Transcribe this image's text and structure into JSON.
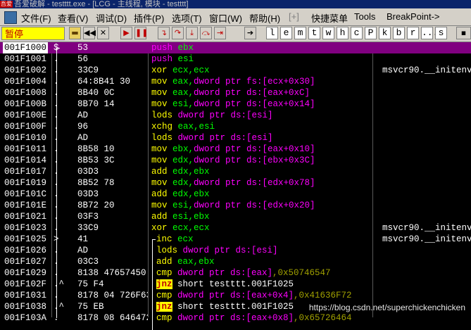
{
  "window": {
    "app_icon_text": "吾爱",
    "title": "吾爱破解 - testttt.exe - [LCG - 主线程, 模块 - testttt]"
  },
  "menu": [
    {
      "label": "文件(F)",
      "name": "menu-file"
    },
    {
      "label": "查看(V)",
      "name": "menu-view"
    },
    {
      "label": "调试(D)",
      "name": "menu-debug"
    },
    {
      "label": "插件(P)",
      "name": "menu-plugins"
    },
    {
      "label": "选项(T)",
      "name": "menu-options"
    },
    {
      "label": "窗口(W)",
      "name": "menu-window"
    },
    {
      "label": "帮助(H)",
      "name": "menu-help"
    },
    {
      "label": "[+]",
      "name": "menu-plus"
    },
    {
      "label": "快捷菜单",
      "name": "menu-shortcuts"
    },
    {
      "label": "Tools",
      "name": "menu-tools"
    },
    {
      "label": "BreakPoint->",
      "name": "menu-breakpoint"
    }
  ],
  "toolbar": {
    "status": "暂停",
    "buttons": [
      "open",
      "rewind",
      "close",
      "run",
      "pause",
      "step-into",
      "step-over",
      "trace-into",
      "trace-over",
      "execute-till-return",
      "goto"
    ],
    "letters": [
      "l",
      "e",
      "m",
      "t",
      "w",
      "h",
      "c",
      "P",
      "k",
      "b",
      "r",
      "...",
      "s"
    ]
  },
  "rows": [
    {
      "addr": "001F1000",
      "mark": "$",
      "hex": "53",
      "asm": [
        [
          "push",
          "purple"
        ],
        [
          " ebx",
          "reg"
        ]
      ],
      "cmt": "",
      "sel": true
    },
    {
      "addr": "001F1001",
      "mark": ".",
      "hex": "56",
      "asm": [
        [
          "push",
          "purple"
        ],
        [
          " esi",
          "reg"
        ]
      ],
      "cmt": ""
    },
    {
      "addr": "001F1002",
      "mark": ".",
      "hex": "33C9",
      "asm": [
        [
          "xor",
          "yellow"
        ],
        [
          " ecx,ecx",
          "reg"
        ]
      ],
      "cmt": "msvcr90.__initenv"
    },
    {
      "addr": "001F1004",
      "mark": ".",
      "hex": "64:8B41 30",
      "asm": [
        [
          "mov",
          "yellow"
        ],
        [
          " eax,",
          "reg"
        ],
        [
          "dword ptr fs:[ecx+0x30]",
          "mem"
        ]
      ],
      "cmt": ""
    },
    {
      "addr": "001F1008",
      "mark": ".",
      "hex": "8B40 0C",
      "asm": [
        [
          "mov",
          "yellow"
        ],
        [
          " eax,",
          "reg"
        ],
        [
          "dword ptr ds:[eax+0xC]",
          "mem"
        ]
      ],
      "cmt": ""
    },
    {
      "addr": "001F100B",
      "mark": ".",
      "hex": "8B70 14",
      "asm": [
        [
          "mov",
          "yellow"
        ],
        [
          " esi,",
          "reg"
        ],
        [
          "dword ptr ds:[eax+0x14]",
          "mem"
        ]
      ],
      "cmt": ""
    },
    {
      "addr": "001F100E",
      "mark": ".",
      "hex": "AD",
      "asm": [
        [
          "lods",
          "yellow"
        ],
        [
          " dword ptr ds:[esi]",
          "mem"
        ]
      ],
      "cmt": ""
    },
    {
      "addr": "001F100F",
      "mark": ".",
      "hex": "96",
      "asm": [
        [
          "xchg",
          "yellow"
        ],
        [
          " eax,esi",
          "reg"
        ]
      ],
      "cmt": ""
    },
    {
      "addr": "001F1010",
      "mark": ".",
      "hex": "AD",
      "asm": [
        [
          "lods",
          "yellow"
        ],
        [
          " dword ptr ds:[esi]",
          "mem"
        ]
      ],
      "cmt": ""
    },
    {
      "addr": "001F1011",
      "mark": ".",
      "hex": "8B58 10",
      "asm": [
        [
          "mov",
          "yellow"
        ],
        [
          " ebx,",
          "reg"
        ],
        [
          "dword ptr ds:[eax+0x10]",
          "mem"
        ]
      ],
      "cmt": ""
    },
    {
      "addr": "001F1014",
      "mark": ".",
      "hex": "8B53 3C",
      "asm": [
        [
          "mov",
          "yellow"
        ],
        [
          " edx,",
          "reg"
        ],
        [
          "dword ptr ds:[ebx+0x3C]",
          "mem"
        ]
      ],
      "cmt": ""
    },
    {
      "addr": "001F1017",
      "mark": ".",
      "hex": "03D3",
      "asm": [
        [
          "add",
          "yellow"
        ],
        [
          " edx,ebx",
          "reg"
        ]
      ],
      "cmt": ""
    },
    {
      "addr": "001F1019",
      "mark": ".",
      "hex": "8B52 78",
      "asm": [
        [
          "mov",
          "yellow"
        ],
        [
          " edx,",
          "reg"
        ],
        [
          "dword ptr ds:[edx+0x78]",
          "mem"
        ]
      ],
      "cmt": ""
    },
    {
      "addr": "001F101C",
      "mark": ".",
      "hex": "03D3",
      "asm": [
        [
          "add",
          "yellow"
        ],
        [
          " edx,ebx",
          "reg"
        ]
      ],
      "cmt": ""
    },
    {
      "addr": "001F101E",
      "mark": ".",
      "hex": "8B72 20",
      "asm": [
        [
          "mov",
          "yellow"
        ],
        [
          " esi,",
          "reg"
        ],
        [
          "dword ptr ds:[edx+0x20]",
          "mem"
        ]
      ],
      "cmt": ""
    },
    {
      "addr": "001F1021",
      "mark": ".",
      "hex": "03F3",
      "asm": [
        [
          "add",
          "yellow"
        ],
        [
          " esi,ebx",
          "reg"
        ]
      ],
      "cmt": ""
    },
    {
      "addr": "001F1023",
      "mark": ".",
      "hex": "33C9",
      "asm": [
        [
          "xor",
          "yellow"
        ],
        [
          " ecx,ecx",
          "reg"
        ]
      ],
      "cmt": "msvcr90.__initenv"
    },
    {
      "addr": "001F1025",
      "mark": ">",
      "hex": "41",
      "asm": [
        [
          "inc",
          "yellow"
        ],
        [
          " ecx",
          "reg"
        ]
      ],
      "cmt": "msvcr90.__initenv",
      "ind": true
    },
    {
      "addr": "001F1026",
      "mark": ".",
      "hex": "AD",
      "asm": [
        [
          "lods",
          "yellow"
        ],
        [
          " dword ptr ds:[esi]",
          "mem"
        ]
      ],
      "cmt": "",
      "ind": true
    },
    {
      "addr": "001F1027",
      "mark": ".",
      "hex": "03C3",
      "asm": [
        [
          "add",
          "yellow"
        ],
        [
          " eax,ebx",
          "reg"
        ]
      ],
      "cmt": "",
      "ind": true
    },
    {
      "addr": "001F1029",
      "mark": ".",
      "hex": "8138 47657450",
      "asm": [
        [
          "cmp",
          "yellow"
        ],
        [
          " dword ptr ds:[eax]",
          "mem"
        ],
        [
          ",0x50746547",
          "imm"
        ]
      ],
      "cmt": "",
      "ind": true
    },
    {
      "addr": "001F102F",
      "mark": ".^",
      "hex": "75 F4",
      "asm": [
        [
          "jnz",
          "jump"
        ],
        [
          " short testttt.001F1025",
          "plain"
        ]
      ],
      "cmt": "",
      "ind": true
    },
    {
      "addr": "001F1031",
      "mark": ".",
      "hex": "8178 04 726F6341",
      "asm": [
        [
          "cmp",
          "yellow"
        ],
        [
          " dword ptr ds:[eax+0x4]",
          "mem"
        ],
        [
          ",0x41636F72",
          "imm"
        ]
      ],
      "cmt": "",
      "ind": true
    },
    {
      "addr": "001F1038",
      "mark": ".^",
      "hex": "75 EB",
      "asm": [
        [
          "jnz",
          "jump"
        ],
        [
          " short testttt.001F1025",
          "plain"
        ]
      ],
      "cmt": "",
      "ind": true
    },
    {
      "addr": "001F103A",
      "mark": ".",
      "hex": "8178 08 64647265",
      "asm": [
        [
          "cmp",
          "yellow"
        ],
        [
          " dword ptr ds:[eax+0x8]",
          "mem"
        ],
        [
          ",0x65726464",
          "imm"
        ]
      ],
      "cmt": "",
      "ind": true
    }
  ],
  "watermark": "https://blog.csdn.net/superchickenchicken"
}
